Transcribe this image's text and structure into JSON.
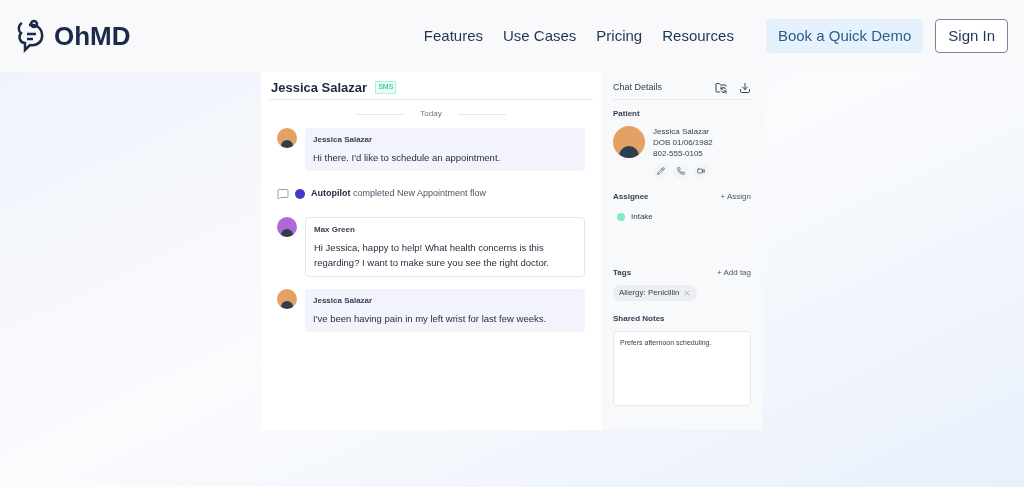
{
  "header": {
    "brand": "OhMD",
    "nav": [
      "Features",
      "Use Cases",
      "Pricing",
      "Resources"
    ],
    "demo_button": "Book a Quick Demo",
    "sign_in": "Sign In"
  },
  "chat": {
    "title": "Jessica Salazar",
    "channel": "SMS",
    "divider": "Today",
    "items": [
      {
        "kind": "patient",
        "sender": "Jessica Salazar",
        "text": "Hi there. I'd like to schedule an appointment."
      },
      {
        "kind": "event",
        "actor": "Autopilot",
        "text": "completed New Appointment flow"
      },
      {
        "kind": "staff",
        "sender": "Max Green",
        "text": "Hi Jessica, happy to help! What health concerns is this regarding? I want to make sure you see the right doctor."
      },
      {
        "kind": "patient",
        "sender": "Jessica Salazar",
        "text": "I've been having pain in my left wrist for last few weeks."
      }
    ]
  },
  "details": {
    "title": "Chat Details",
    "patient_label": "Patient",
    "patient": {
      "name": "Jessica Salazar",
      "dob": "DOB 01/06/1982",
      "phone": "802-555-0105"
    },
    "assignee_label": "Assignee",
    "assign_action": "+ Assign",
    "assignees": [
      {
        "name": "Intake",
        "color": "#7eecc6"
      }
    ],
    "tags_label": "Tags",
    "add_tag": "+ Add tag",
    "tags": [
      "Allergy: Penicillin"
    ],
    "notes_label": "Shared Notes",
    "notes": "Prefers afternoon scheduling."
  }
}
